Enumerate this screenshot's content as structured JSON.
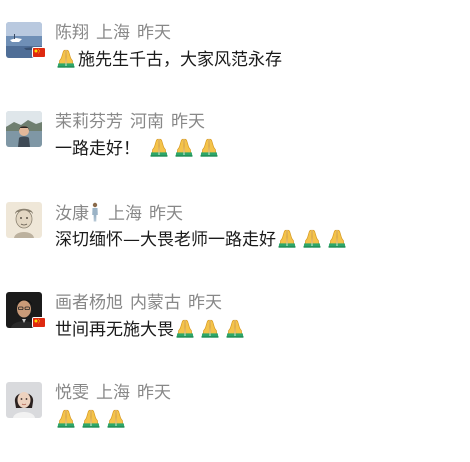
{
  "comments": [
    {
      "name": "陈翔",
      "location": "上海",
      "time": "昨天",
      "text": "施先生千古，大家风范永存",
      "avatar_icon": "seascape-photo-avatar",
      "has_flag": true
    },
    {
      "name": "茉莉芬芳",
      "location": "河南",
      "time": "昨天",
      "text": "一路走好！",
      "avatar_icon": "lake-portrait-avatar",
      "has_flag": false
    },
    {
      "name": "汝康",
      "location": "上海",
      "time": "昨天",
      "text": "深切缅怀—大畏老师一路走好",
      "avatar_icon": "sketch-portrait-avatar",
      "has_flag": false,
      "name_icon": "standing-person-icon"
    },
    {
      "name": "画者杨旭",
      "location": "内蒙古",
      "time": "昨天",
      "text": "世间再无施大畏",
      "avatar_icon": "man-portrait-avatar",
      "has_flag": true
    },
    {
      "name": "悦雯",
      "location": "上海",
      "time": "昨天",
      "text": "",
      "avatar_icon": "woman-portrait-avatar",
      "has_flag": false
    }
  ],
  "emoji": {
    "pray": "folded-hands-icon"
  },
  "colors": {
    "meta_text": "#888888",
    "body_text": "#1a1a1a",
    "flag_red": "#de2910",
    "flag_yellow": "#ffde00"
  }
}
